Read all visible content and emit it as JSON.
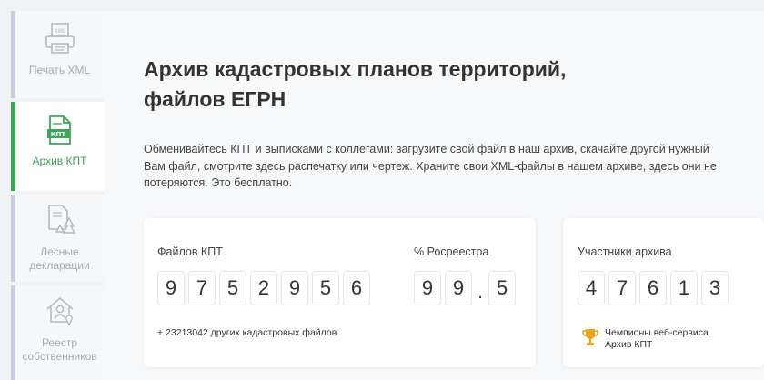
{
  "sidebar": {
    "items": [
      {
        "label": "Печать XML",
        "icon": "print-xml-icon",
        "active": false
      },
      {
        "label": "Архив КПТ",
        "icon": "archive-kpt-icon",
        "active": true
      },
      {
        "label": "Лесные декларации",
        "icon": "forest-declaration-icon",
        "active": false
      },
      {
        "label": "Реестр собственников",
        "icon": "owners-registry-icon",
        "active": false
      }
    ]
  },
  "main": {
    "title_line1": "Архив кадастровых планов территорий,",
    "title_line2": "файлов ЕГРН",
    "description": "Обменивайтесь КПТ и выписками с коллегами: загрузите свой файл в наш архив, скачайте другой нужный Вам файл, смотрите здесь распечатку или чертеж. Храните свои XML-файлы в нашем архиве, здесь они не потеряются. Это бесплатно."
  },
  "stats": {
    "files_label": "Файлов КПТ",
    "files_digits": [
      "9",
      "7",
      "5",
      "2",
      "9",
      "5",
      "6"
    ],
    "rosreestr_label": "% Росреестра",
    "rosreestr_digits": [
      "9",
      "9",
      ".",
      "5"
    ],
    "other_files_note": "+ 23213042 других кадастровых файлов",
    "participants_label": "Участники архива",
    "participants_digits": [
      "4",
      "7",
      "6",
      "1",
      "3"
    ],
    "champions_line1": "Чемпионы веб-сервиса",
    "champions_line2": "Архив КПТ"
  },
  "colors": {
    "accent": "#3aa657",
    "inactive_border": "#c9cfe0",
    "trophy": "#e8a317"
  }
}
